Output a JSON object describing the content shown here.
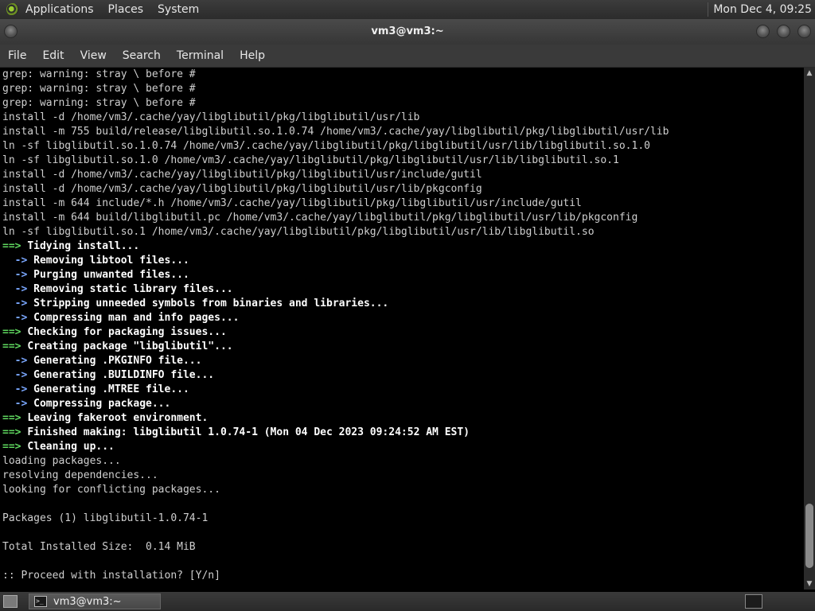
{
  "top_panel": {
    "menus": [
      "Applications",
      "Places",
      "System"
    ],
    "clock": "Mon Dec  4, 09:25"
  },
  "window": {
    "title": "vm3@vm3:~"
  },
  "menubar": [
    "File",
    "Edit",
    "View",
    "Search",
    "Terminal",
    "Help"
  ],
  "terminal": {
    "lines": [
      {
        "segs": [
          {
            "t": "grep: warning: stray \\ before #",
            "c": ""
          }
        ]
      },
      {
        "segs": [
          {
            "t": "grep: warning: stray \\ before #",
            "c": ""
          }
        ]
      },
      {
        "segs": [
          {
            "t": "grep: warning: stray \\ before #",
            "c": ""
          }
        ]
      },
      {
        "segs": [
          {
            "t": "install -d /home/vm3/.cache/yay/libglibutil/pkg/libglibutil/usr/lib",
            "c": ""
          }
        ]
      },
      {
        "segs": [
          {
            "t": "install -m 755 build/release/libglibutil.so.1.0.74 /home/vm3/.cache/yay/libglibutil/pkg/libglibutil/usr/lib",
            "c": ""
          }
        ]
      },
      {
        "segs": [
          {
            "t": "ln -sf libglibutil.so.1.0.74 /home/vm3/.cache/yay/libglibutil/pkg/libglibutil/usr/lib/libglibutil.so.1.0",
            "c": ""
          }
        ]
      },
      {
        "segs": [
          {
            "t": "ln -sf libglibutil.so.1.0 /home/vm3/.cache/yay/libglibutil/pkg/libglibutil/usr/lib/libglibutil.so.1",
            "c": ""
          }
        ]
      },
      {
        "segs": [
          {
            "t": "install -d /home/vm3/.cache/yay/libglibutil/pkg/libglibutil/usr/include/gutil",
            "c": ""
          }
        ]
      },
      {
        "segs": [
          {
            "t": "install -d /home/vm3/.cache/yay/libglibutil/pkg/libglibutil/usr/lib/pkgconfig",
            "c": ""
          }
        ]
      },
      {
        "segs": [
          {
            "t": "install -m 644 include/*.h /home/vm3/.cache/yay/libglibutil/pkg/libglibutil/usr/include/gutil",
            "c": ""
          }
        ]
      },
      {
        "segs": [
          {
            "t": "install -m 644 build/libglibutil.pc /home/vm3/.cache/yay/libglibutil/pkg/libglibutil/usr/lib/pkgconfig",
            "c": ""
          }
        ]
      },
      {
        "segs": [
          {
            "t": "ln -sf libglibutil.so.1 /home/vm3/.cache/yay/libglibutil/pkg/libglibutil/usr/lib/libglibutil.so",
            "c": ""
          }
        ]
      },
      {
        "segs": [
          {
            "t": "==> ",
            "c": "green"
          },
          {
            "t": "Tidying install...",
            "c": "bold"
          }
        ]
      },
      {
        "segs": [
          {
            "t": "  -> ",
            "c": "blue"
          },
          {
            "t": "Removing libtool files...",
            "c": "bold"
          }
        ]
      },
      {
        "segs": [
          {
            "t": "  -> ",
            "c": "blue"
          },
          {
            "t": "Purging unwanted files...",
            "c": "bold"
          }
        ]
      },
      {
        "segs": [
          {
            "t": "  -> ",
            "c": "blue"
          },
          {
            "t": "Removing static library files...",
            "c": "bold"
          }
        ]
      },
      {
        "segs": [
          {
            "t": "  -> ",
            "c": "blue"
          },
          {
            "t": "Stripping unneeded symbols from binaries and libraries...",
            "c": "bold"
          }
        ]
      },
      {
        "segs": [
          {
            "t": "  -> ",
            "c": "blue"
          },
          {
            "t": "Compressing man and info pages...",
            "c": "bold"
          }
        ]
      },
      {
        "segs": [
          {
            "t": "==> ",
            "c": "green"
          },
          {
            "t": "Checking for packaging issues...",
            "c": "bold"
          }
        ]
      },
      {
        "segs": [
          {
            "t": "==> ",
            "c": "green"
          },
          {
            "t": "Creating package \"libglibutil\"...",
            "c": "bold"
          }
        ]
      },
      {
        "segs": [
          {
            "t": "  -> ",
            "c": "blue"
          },
          {
            "t": "Generating .PKGINFO file...",
            "c": "bold"
          }
        ]
      },
      {
        "segs": [
          {
            "t": "  -> ",
            "c": "blue"
          },
          {
            "t": "Generating .BUILDINFO file...",
            "c": "bold"
          }
        ]
      },
      {
        "segs": [
          {
            "t": "  -> ",
            "c": "blue"
          },
          {
            "t": "Generating .MTREE file...",
            "c": "bold"
          }
        ]
      },
      {
        "segs": [
          {
            "t": "  -> ",
            "c": "blue"
          },
          {
            "t": "Compressing package...",
            "c": "bold"
          }
        ]
      },
      {
        "segs": [
          {
            "t": "==> ",
            "c": "green"
          },
          {
            "t": "Leaving fakeroot environment.",
            "c": "bold"
          }
        ]
      },
      {
        "segs": [
          {
            "t": "==> ",
            "c": "green"
          },
          {
            "t": "Finished making: libglibutil 1.0.74-1 (Mon 04 Dec 2023 09:24:52 AM EST)",
            "c": "bold"
          }
        ]
      },
      {
        "segs": [
          {
            "t": "==> ",
            "c": "green"
          },
          {
            "t": "Cleaning up...",
            "c": "bold"
          }
        ]
      },
      {
        "segs": [
          {
            "t": "loading packages...",
            "c": ""
          }
        ]
      },
      {
        "segs": [
          {
            "t": "resolving dependencies...",
            "c": ""
          }
        ]
      },
      {
        "segs": [
          {
            "t": "looking for conflicting packages...",
            "c": ""
          }
        ]
      },
      {
        "segs": [
          {
            "t": "",
            "c": ""
          }
        ]
      },
      {
        "segs": [
          {
            "t": "Packages (1) libglibutil-1.0.74-1",
            "c": ""
          }
        ]
      },
      {
        "segs": [
          {
            "t": "",
            "c": ""
          }
        ]
      },
      {
        "segs": [
          {
            "t": "Total Installed Size:  0.14 MiB",
            "c": ""
          }
        ]
      },
      {
        "segs": [
          {
            "t": "",
            "c": ""
          }
        ]
      },
      {
        "segs": [
          {
            "t": ":: Proceed with installation? [Y/n]",
            "c": ""
          }
        ]
      }
    ]
  },
  "scroll": {
    "thumb_top_fraction": 0.85,
    "thumb_size_fraction": 0.13
  },
  "bottom_panel": {
    "task_label": "vm3@vm3:~"
  },
  "icons": {
    "logo": "distro-logo-icon",
    "show_desktop": "show-desktop-icon",
    "terminal": "terminal-icon",
    "tray": "workspace-switcher-icon"
  }
}
